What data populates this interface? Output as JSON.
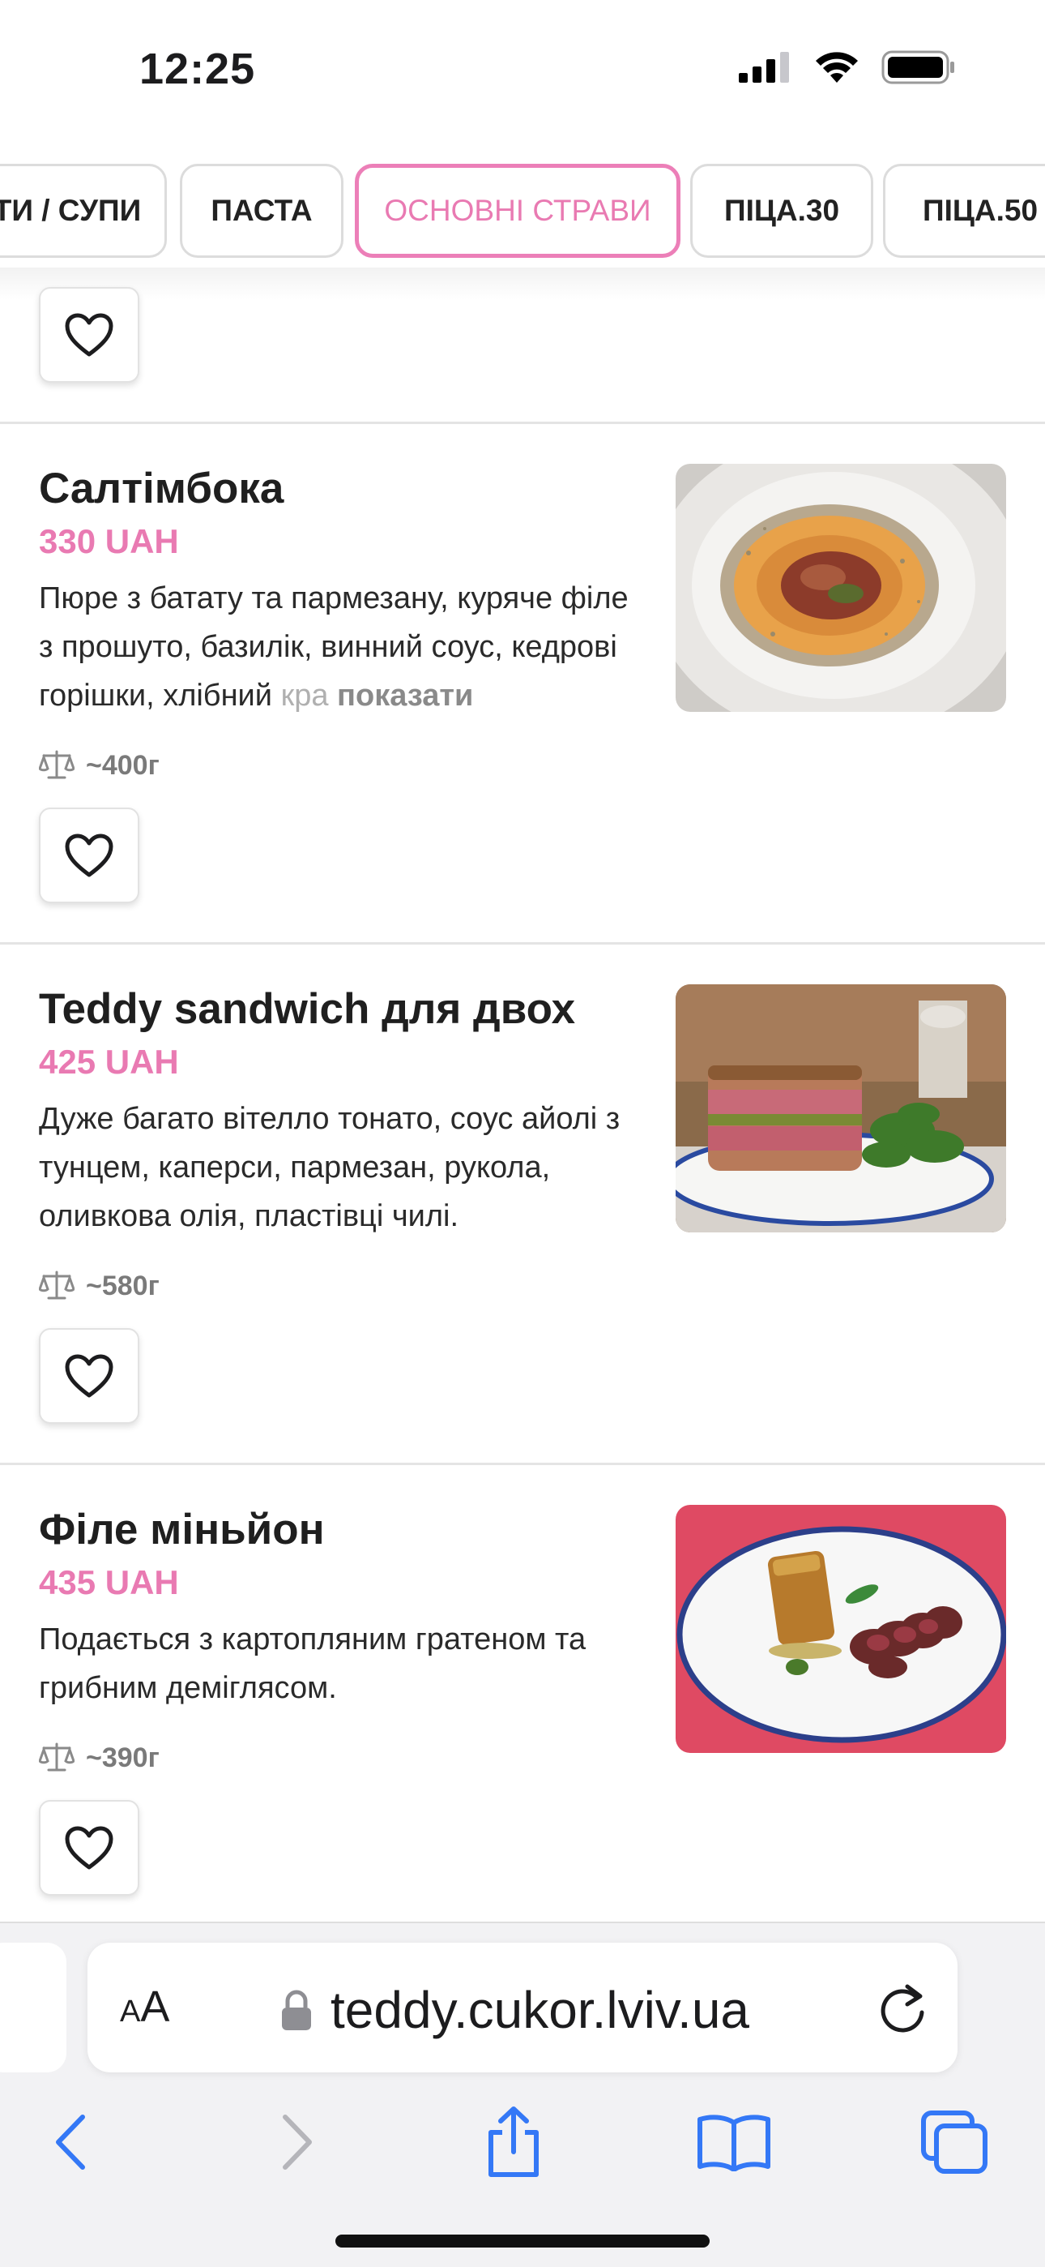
{
  "status": {
    "time": "12:25"
  },
  "tabs": [
    {
      "label": "ТИ / СУПИ",
      "active": false
    },
    {
      "label": "ПАСТА",
      "active": false
    },
    {
      "label": "ОСНОВНІ СТРАВИ",
      "active": true
    },
    {
      "label": "ПІЦА.30",
      "active": false
    },
    {
      "label": "ПІЦА.50",
      "active": false
    }
  ],
  "items": [
    {
      "title": "Салтімбока",
      "price": "330 UAH",
      "desc_main": "Пюре з батату та пармезану, куряче філе з прошуто, базилік, винний соус, кедрові горішки, хлібний ",
      "desc_fade": "кра",
      "more": "показати",
      "weight": "~400г"
    },
    {
      "title": "Teddy sandwich для двох",
      "price": "425 UAH",
      "desc_main": "Дуже багато вітелло тонато, соус айолі з тунцем, каперси, пармезан, рукола, оливкова олія, пластівці чилі.",
      "weight": "~580г"
    },
    {
      "title": "Філе міньйон",
      "price": "435 UAH",
      "desc_main": "Подається з картопляним гратеном та грибним деміглясом.",
      "weight": "~390г"
    }
  ],
  "browser": {
    "aa_small": "A",
    "aa_large": "A",
    "url": "teddy.cukor.lviv.ua"
  },
  "colors": {
    "accent": "#e97ab2",
    "active_tab_border": "#ec7fb8",
    "browser_blue": "#3478f6"
  }
}
